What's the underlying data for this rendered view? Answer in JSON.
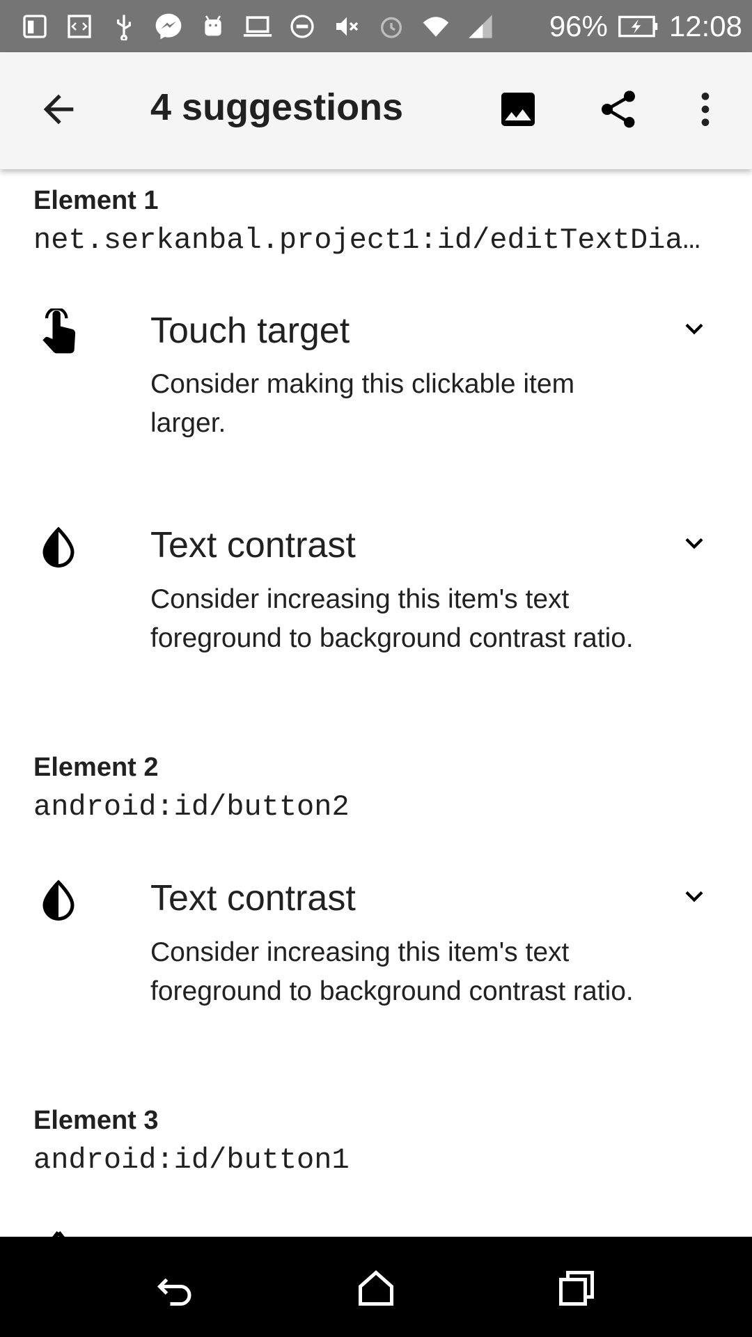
{
  "status_bar": {
    "battery": "96%",
    "time": "12:08",
    "icons": [
      "sim-card-icon",
      "code-icon",
      "usb-icon",
      "messenger-icon",
      "android-icon",
      "laptop-icon",
      "do-not-disturb-icon",
      "mute-icon",
      "alarm-icon",
      "wifi-icon",
      "signal-icon",
      "battery-charging-icon"
    ]
  },
  "app_bar": {
    "title": "4 suggestions",
    "back_icon": "arrow-back-icon",
    "actions": [
      "image-icon",
      "share-icon",
      "more-vert-icon"
    ]
  },
  "elements": [
    {
      "heading": "Element 1",
      "id": "net.serkanbal.project1:id/editTextDial…",
      "suggestions": [
        {
          "icon": "touch-icon",
          "title": "Touch target",
          "description": "Consider making this clickable item larger."
        },
        {
          "icon": "contrast-icon",
          "title": "Text contrast",
          "description": "Consider increasing this item's text foreground to background contrast ratio."
        }
      ]
    },
    {
      "heading": "Element 2",
      "id": "android:id/button2",
      "suggestions": [
        {
          "icon": "contrast-icon",
          "title": "Text contrast",
          "description": "Consider increasing this item's text foreground to background contrast ratio."
        }
      ]
    },
    {
      "heading": "Element 3",
      "id": "android:id/button1",
      "suggestions": []
    }
  ],
  "nav_bar": [
    "back-nav-icon",
    "home-nav-icon",
    "recents-nav-icon"
  ]
}
